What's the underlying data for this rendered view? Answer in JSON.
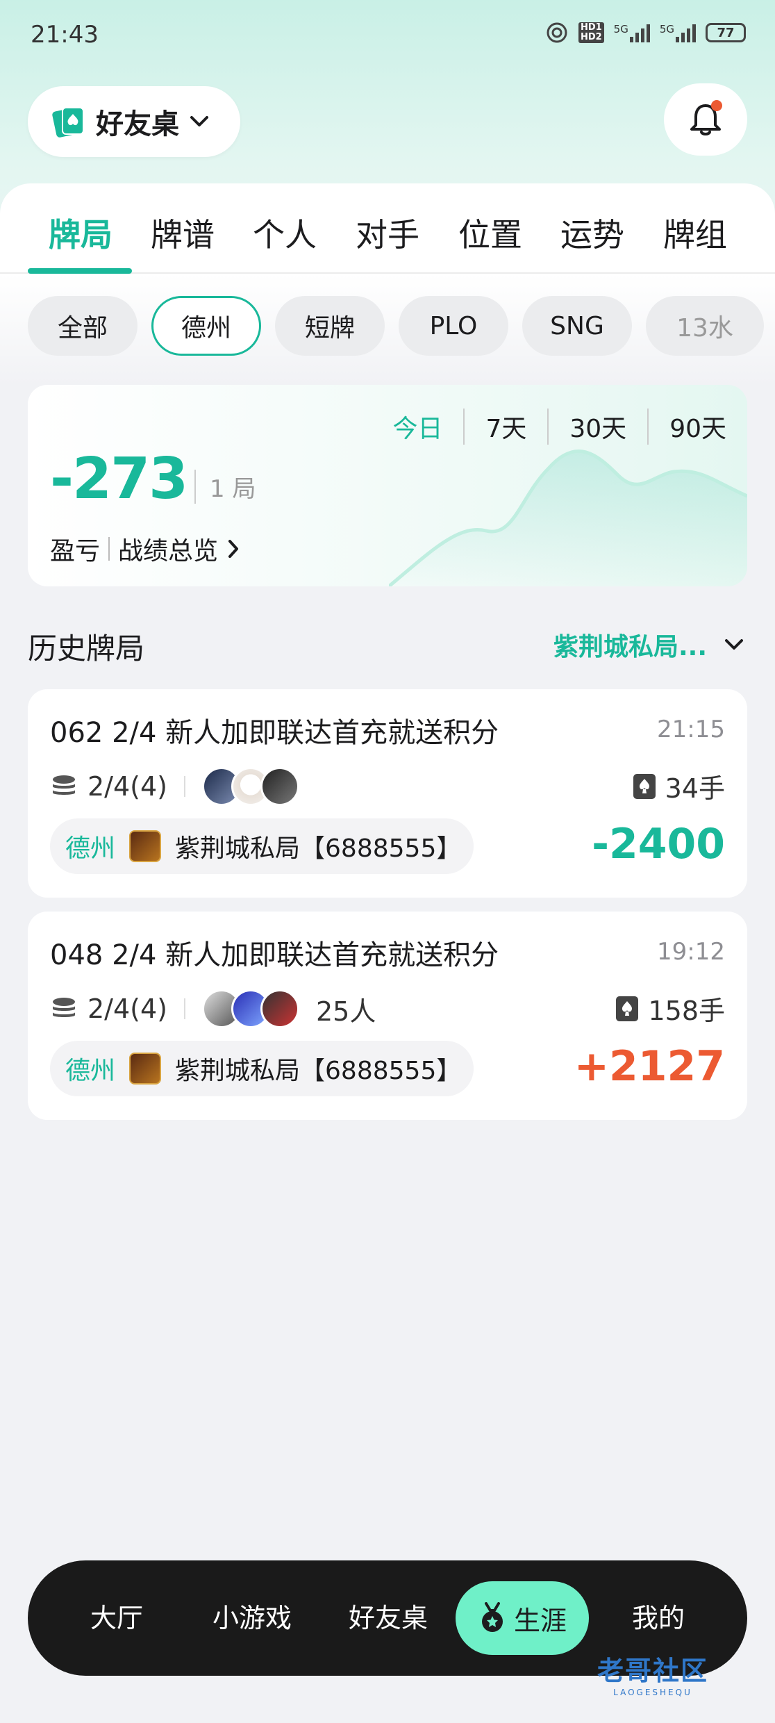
{
  "status_bar": {
    "time": "21:43",
    "battery": "77",
    "network1": "5G",
    "network2": "5G",
    "hd1": "HD1",
    "hd2": "HD2"
  },
  "header": {
    "mode_label": "好友桌"
  },
  "tabs": [
    "牌局",
    "牌谱",
    "个人",
    "对手",
    "位置",
    "运势",
    "牌组"
  ],
  "filters": [
    "全部",
    "德州",
    "短牌",
    "PLO",
    "SNG",
    "13水"
  ],
  "stats": {
    "ranges": [
      "今日",
      "7天",
      "30天",
      "90天"
    ],
    "pnl": "-273",
    "games": "1 局",
    "pnl_label": "盈亏",
    "overview_link": "战绩总览"
  },
  "history": {
    "title": "历史牌局",
    "club_filter": "紫荆城私局..."
  },
  "games": [
    {
      "title": "062 2/4 新人加即联达首充就送积分",
      "time": "21:15",
      "stake": "2/4(4)",
      "players": "",
      "hands": "34手",
      "type": "德州",
      "club": "紫荆城私局【6888555】",
      "result": "-2400"
    },
    {
      "title": "048 2/4 新人加即联达首充就送积分",
      "time": "19:12",
      "stake": "2/4(4)",
      "players": "25人",
      "hands": "158手",
      "type": "德州",
      "club": "紫荆城私局【6888555】",
      "result": "+2127"
    }
  ],
  "bottom_nav": [
    "大厅",
    "小游戏",
    "好友桌",
    "生涯",
    "我的"
  ],
  "watermark": {
    "text": "老哥社区",
    "sub": "LAOGESHEQU"
  },
  "colors": {
    "accent": "#19b89a",
    "positive": "#ec5a32",
    "nav_bg": "#1a1a1a",
    "nav_active": "#6ff0c8"
  }
}
